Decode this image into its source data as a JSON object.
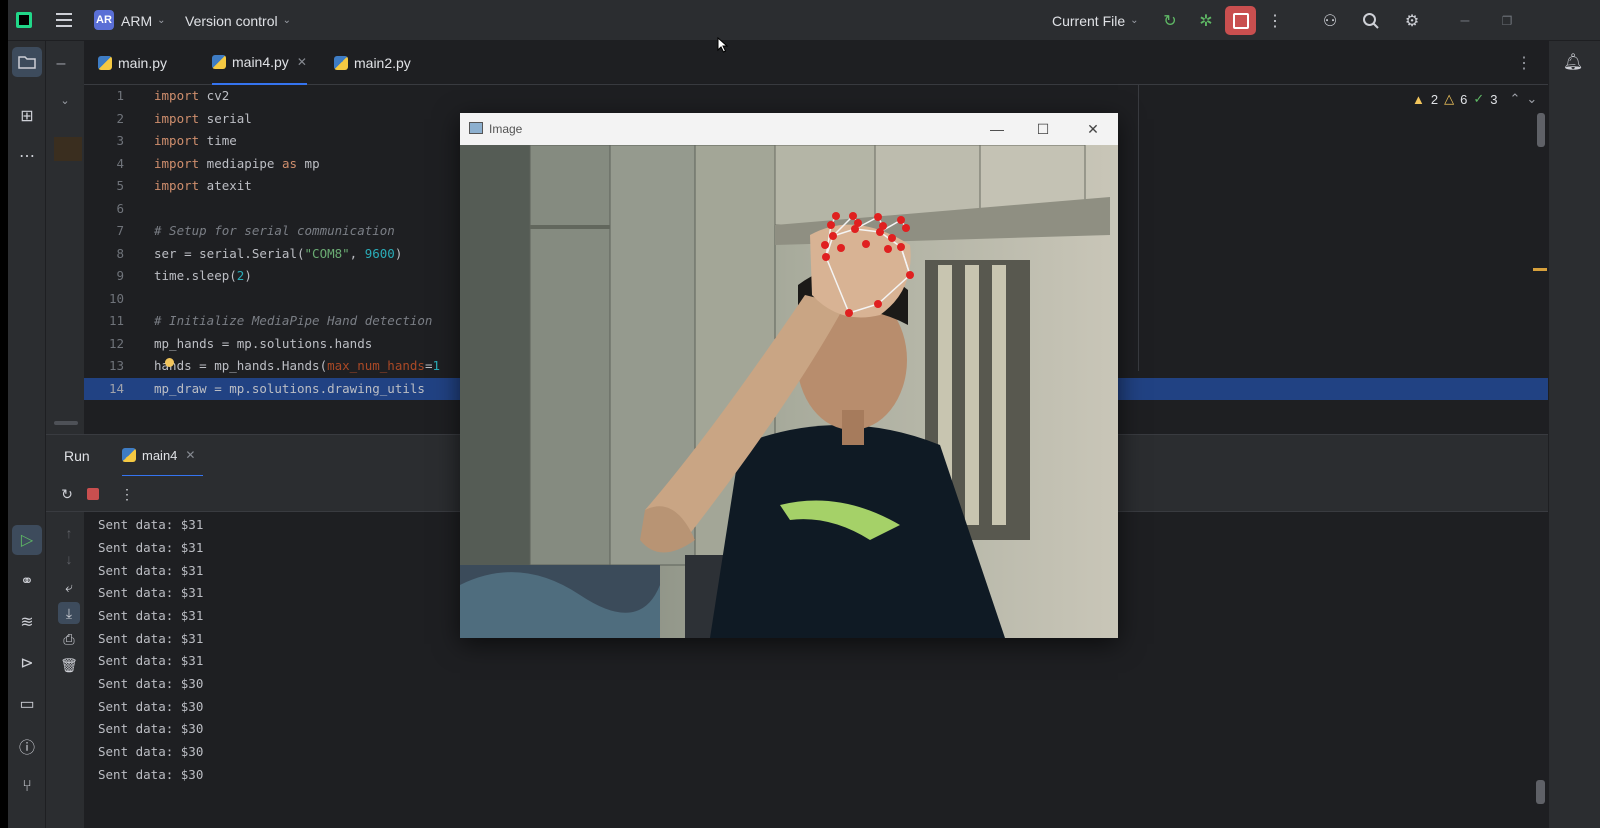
{
  "titlebar": {
    "project_badge": "AR",
    "project_name": "ARM",
    "vcs_label": "Version control",
    "run_config": "Current File"
  },
  "tabs": [
    {
      "label": "main.py",
      "active": false
    },
    {
      "label": "main4.py",
      "active": true
    },
    {
      "label": "main2.py",
      "active": false
    }
  ],
  "editor": {
    "line_numbers": [
      "1",
      "2",
      "3",
      "4",
      "5",
      "6",
      "7",
      "8",
      "9",
      "10",
      "11",
      "12",
      "13",
      "14"
    ],
    "current_line": 14,
    "inspections": {
      "warnings_a": "2",
      "warnings_b": "6",
      "ok": "3"
    }
  },
  "run_panel": {
    "title": "Run",
    "tab_label": "main4",
    "output": [
      "Sent data: $31",
      "Sent data: $31",
      "Sent data: $31",
      "Sent data: $31",
      "Sent data: $31",
      "Sent data: $31",
      "Sent data: $31",
      "Sent data: $30",
      "Sent data: $30",
      "Sent data: $30",
      "Sent data: $30",
      "Sent data: $30"
    ]
  },
  "image_window": {
    "title": "Image"
  },
  "colors": {
    "accent": "#3574f0",
    "current_line": "#214283",
    "stop": "#c94f4f",
    "landmark": "#e02020"
  }
}
